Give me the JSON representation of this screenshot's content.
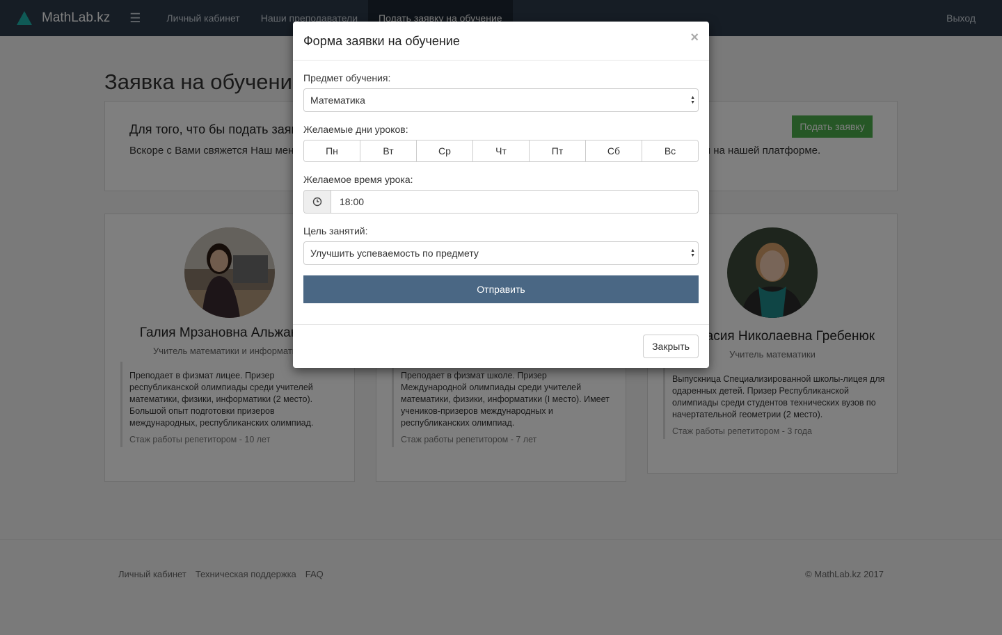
{
  "navbar": {
    "brand": "MathLab.kz",
    "menu_icon": "☰",
    "links": [
      "Личный кабинет",
      "Наши преподаватели",
      "Подать заявку на обучение"
    ],
    "logout": "Выход"
  },
  "page": {
    "title": "Заявка на обучение",
    "intro_heading": "Для того, что бы подать заявку",
    "intro_text": "Вскоре с Вами свяжется Наш менеджер, который ответит на все Ваши вопросы, а так же расскажет как проходят уроки на нашей платформе.",
    "apply_button": "Подать заявку"
  },
  "teachers": [
    {
      "name": "Галия Мрзановна Альжанова",
      "role": "Учитель математики и информатики",
      "desc": "Преподает в физмат лицее. Призер республиканской олимпиады среди учителей математики, физики, информатики (2 место). Большой опыт подготовки призеров международных, республиканских олимпиад.",
      "experience": "Стаж работы репетитором - 10 лет"
    },
    {
      "name": "",
      "role": "",
      "desc": "Преподает в физмат школе. Призер Международной олимпиады среди учителей математики, физики, информатики (I место). Имеет учеников-призеров международных и республиканских олимпиад.",
      "experience": "Стаж работы репетитором - 7 лет"
    },
    {
      "name": "Анастасия Николаевна Гребенюк",
      "role": "Учитель математики",
      "desc": "Выпускница Специализированной школы-лицея для одаренных детей. Призер Республиканской олимпиады среди студентов технических вузов по начертательной геометрии (2 место).",
      "experience": "Стаж работы репетитором - 3 года"
    }
  ],
  "footer": {
    "links": [
      "Личный кабинет",
      "Техническая поддержка",
      "FAQ"
    ],
    "copyright": "© MathLab.kz 2017"
  },
  "modal": {
    "title": "Форма заявки на обучение",
    "close_x": "×",
    "subject_label": "Предмет обучения:",
    "subject_value": "Математика",
    "days_label": "Желаемые дни уроков:",
    "days": [
      "Пн",
      "Вт",
      "Ср",
      "Чт",
      "Пт",
      "Сб",
      "Вс"
    ],
    "time_label": "Желаемое время урока:",
    "time_value": "18:00",
    "goal_label": "Цель занятий:",
    "goal_value": "Улучшить успеваемость по предмету",
    "submit": "Отправить",
    "close_button": "Закрыть"
  },
  "colors": {
    "navbar": "#2c3a4b",
    "brand_accent": "#1fb5ad",
    "apply_button": "#4cae4c",
    "submit_button": "#4a6784"
  },
  "icons": {
    "time_addon": "clock-icon",
    "select_arrows": "select-arrows-icon",
    "menu": "hamburger-icon"
  }
}
